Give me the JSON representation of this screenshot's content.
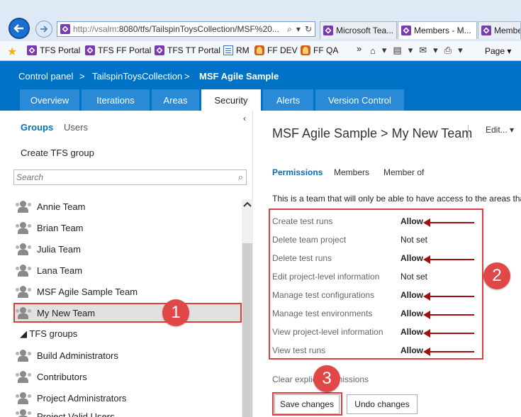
{
  "browser": {
    "address_host": "http://vsalm",
    "address_rest": ":8080/tfs/TailspinToysCollection/MSF%20...",
    "address_icons": [
      "⌕",
      "▾",
      "↻"
    ],
    "tabs": [
      {
        "label": "Microsoft Tea...",
        "close": ""
      },
      {
        "label": "Members - M...",
        "close": "✕"
      },
      {
        "label": "Membe",
        "close": ""
      }
    ],
    "favorites": [
      {
        "label": "TFS Portal",
        "icon": "vs-logo-icon"
      },
      {
        "label": "TFS FF Portal",
        "icon": "vs-logo-icon"
      },
      {
        "label": "TFS TT Portal",
        "icon": "vs-logo-icon"
      },
      {
        "label": "RM",
        "icon": "rm-icon"
      },
      {
        "label": "FF DEV",
        "icon": "ff-icon"
      },
      {
        "label": "FF QA",
        "icon": "ff-icon"
      }
    ],
    "more_favorites": "»",
    "tools": [
      "⌂",
      "▾",
      "▤",
      "▾",
      "✉",
      "▾",
      "⎙",
      "▾"
    ],
    "page_menu": "Page ▾"
  },
  "header": {
    "breadcrumb": [
      "Control panel",
      "TailspinToysCollection",
      "MSF Agile Sample"
    ],
    "separator": ">"
  },
  "tabs": [
    "Overview",
    "Iterations",
    "Areas",
    "Security",
    "Alerts",
    "Version Control"
  ],
  "active_tab": "Security",
  "left_pane": {
    "collapse_caret": "‹",
    "groups_label": "Groups",
    "users_label": "Users",
    "create_group": "Create TFS group",
    "search_placeholder": "Search",
    "teams": [
      "Annie Team",
      "Brian Team",
      "Julia Team",
      "Lana Team",
      "MSF Agile Sample Team",
      "My New Team"
    ],
    "selected_team": "My New Team",
    "tfs_groups_label": "◢ TFS groups",
    "tfs_groups": [
      "Build Administrators",
      "Contributors",
      "Project Administrators",
      "Project Valid Users"
    ]
  },
  "right_pane": {
    "title": "MSF Agile Sample > My New Team",
    "edit_label": "Edit... ▾",
    "subtabs": [
      "Permissions",
      "Members",
      "Member of"
    ],
    "active_subtab": "Permissions",
    "description": "This is a team that will only be able to have access to the areas that",
    "permissions": [
      {
        "name": "Create test runs",
        "value": "Allow",
        "bold": true
      },
      {
        "name": "Delete team project",
        "value": "Not set",
        "bold": false
      },
      {
        "name": "Delete test runs",
        "value": "Allow",
        "bold": true
      },
      {
        "name": "Edit project-level information",
        "value": "Not set",
        "bold": false
      },
      {
        "name": "Manage test configurations",
        "value": "Allow",
        "bold": true
      },
      {
        "name": "Manage test environments",
        "value": "Allow",
        "bold": true
      },
      {
        "name": "View project-level information",
        "value": "Allow",
        "bold": true
      },
      {
        "name": "View test runs",
        "value": "Allow",
        "bold": true
      }
    ],
    "clear_explicit": "Clear explicit permissions",
    "save_button": "Save changes",
    "undo_button": "Undo changes"
  },
  "callouts": [
    "1",
    "2",
    "3"
  ],
  "colors": {
    "tfs_blue": "#0072c6",
    "tab_blue": "#2b8ad6",
    "annotation_red": "#e03e3e",
    "arrow_darkred": "#a01010"
  }
}
